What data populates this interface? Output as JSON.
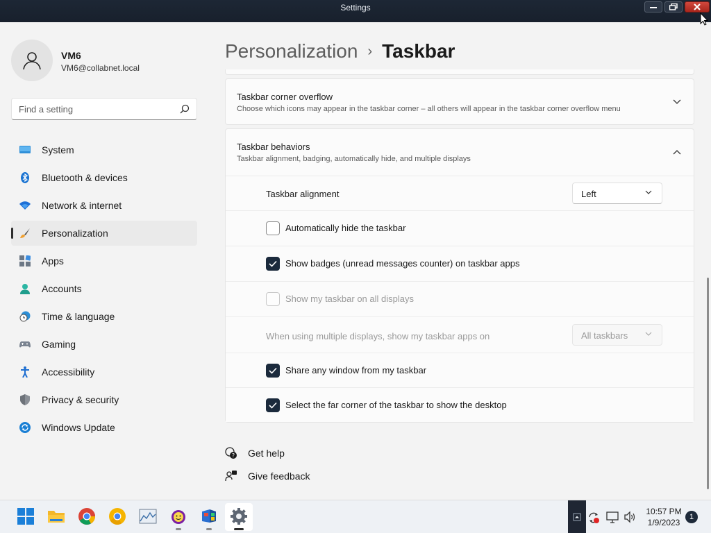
{
  "window": {
    "title": "Settings"
  },
  "user": {
    "name": "VM6",
    "email": "VM6@collabnet.local"
  },
  "search": {
    "placeholder": "Find a setting"
  },
  "sidebar": {
    "items": [
      {
        "label": "System",
        "icon": "system-icon",
        "active": false
      },
      {
        "label": "Bluetooth & devices",
        "icon": "bluetooth-icon",
        "active": false
      },
      {
        "label": "Network & internet",
        "icon": "wifi-icon",
        "active": false
      },
      {
        "label": "Personalization",
        "icon": "brush-icon",
        "active": true
      },
      {
        "label": "Apps",
        "icon": "apps-icon",
        "active": false
      },
      {
        "label": "Accounts",
        "icon": "accounts-icon",
        "active": false
      },
      {
        "label": "Time & language",
        "icon": "clock-globe-icon",
        "active": false
      },
      {
        "label": "Gaming",
        "icon": "gamepad-icon",
        "active": false
      },
      {
        "label": "Accessibility",
        "icon": "accessibility-icon",
        "active": false
      },
      {
        "label": "Privacy & security",
        "icon": "shield-icon",
        "active": false
      },
      {
        "label": "Windows Update",
        "icon": "update-icon",
        "active": false
      }
    ]
  },
  "breadcrumb": {
    "parent": "Personalization",
    "separator": "›",
    "current": "Taskbar"
  },
  "sections": {
    "corner_overflow": {
      "title": "Taskbar corner overflow",
      "subtitle": "Choose which icons may appear in the taskbar corner – all others will appear in the taskbar corner overflow menu"
    },
    "behaviors": {
      "title": "Taskbar behaviors",
      "subtitle": "Taskbar alignment, badging, automatically hide, and multiple displays",
      "alignment_label": "Taskbar alignment",
      "alignment_value": "Left",
      "options": [
        {
          "label": "Automatically hide the taskbar",
          "checked": false,
          "disabled": false
        },
        {
          "label": "Show badges (unread messages counter) on taskbar apps",
          "checked": true,
          "disabled": false
        },
        {
          "label": "Show my taskbar on all displays",
          "checked": false,
          "disabled": true
        }
      ],
      "multi_display_label": "When using multiple displays, show my taskbar apps on",
      "multi_display_value": "All taskbars",
      "options2": [
        {
          "label": "Share any window from my taskbar",
          "checked": true,
          "disabled": false
        },
        {
          "label": "Select the far corner of the taskbar to show the desktop",
          "checked": true,
          "disabled": false
        }
      ]
    }
  },
  "links": {
    "help": "Get help",
    "feedback": "Give feedback"
  },
  "taskbar": {
    "apps": [
      "start-icon",
      "file-explorer-icon",
      "chrome-icon",
      "chrome-canary-icon",
      "chart-app-icon",
      "yahoo-icon",
      "windows-box-icon",
      "settings-icon"
    ],
    "time": "10:57 PM",
    "date": "1/9/2023",
    "notifications": "1"
  },
  "colors": {
    "accent": "#1b2a3c",
    "titlebar": "#1d2735",
    "close": "#c4372d",
    "background": "#f3f3f3"
  }
}
